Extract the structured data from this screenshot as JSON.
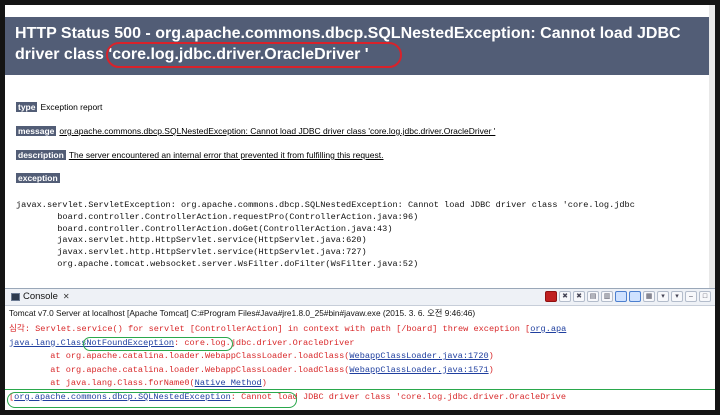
{
  "error_page": {
    "header_line1": "HTTP Status 500 - org.apache.commons.dbcp.SQLNestedException: Cannot load JDBC",
    "header_line2_prefix": "driver class ",
    "header_line2_class": "'core.log.jdbc.driver.OracleDriver '",
    "type_label": "type",
    "type_value": "Exception report",
    "message_label": "message",
    "message_value": "org.apache.commons.dbcp.SQLNestedException: Cannot load JDBC driver class 'core.log.jdbc.driver.OracleDriver '",
    "description_label": "description",
    "description_value": "The server encountered an internal error that prevented it from fulfilling this request.",
    "exception_label": "exception",
    "trace": [
      "javax.servlet.ServletException: org.apache.commons.dbcp.SQLNestedException: Cannot load JDBC driver class 'core.log.jdbc",
      "\tboard.controller.ControllerAction.requestPro(ControllerAction.java:96)",
      "\tboard.controller.ControllerAction.doGet(ControllerAction.java:43)",
      "\tjavax.servlet.http.HttpServlet.service(HttpServlet.java:620)",
      "\tjavax.servlet.http.HttpServlet.service(HttpServlet.java:727)",
      "\torg.apache.tomcat.websocket.server.WsFilter.doFilter(WsFilter.java:52)"
    ]
  },
  "console": {
    "tab_label": "Console",
    "tab_close": "✕",
    "info": "Tomcat v7.0 Server at localhost [Apache Tomcat] C:#Program Files#Java#jre1.8.0_25#bin#javaw.exe (2015. 3. 6. 오전 9:46:46)",
    "line1_text": "심각: Servlet.service() for servlet [ControllerAction] in context with path [/board] threw exception [",
    "line1_link": "org.apa",
    "line2_link": "java.lang.ClassNotFoundException",
    "line2_text": ": core.log.jdbc.driver.OracleDriver",
    "line3_prefix": "\tat org.apache.catalina.loader.WebappClassLoader.loadClass(",
    "line3_link": "WebappClassLoader.java:1720",
    "line4_prefix": "\tat org.apache.catalina.loader.WebappClassLoader.loadClass(",
    "line4_link": "WebappClassLoader.java:1571",
    "line5_prefix": "\tat java.lang.Class.forName0(",
    "line5_link": "Native Method",
    "line6_link": "org.apache.commons.dbcp.SQLNestedException",
    "line6_text": ": Cannot load JDBC driver class 'core.log.jdbc.driver.OracleDrive",
    "paren_close": ")",
    "bracket_close": "]"
  },
  "colors": {
    "header_bg": "#525d76",
    "annotation_red": "#d9222a",
    "annotation_green": "#2aa84c",
    "console_error": "#d8282a",
    "console_link": "#1f3f9f"
  },
  "icons": [
    "console-icon",
    "terminate-icon",
    "remove-launch-icon",
    "remove-all-icon",
    "clear-console-icon",
    "scroll-lock-icon",
    "show-on-output-icon",
    "show-on-error-icon",
    "pin-console-icon",
    "display-selected-console-icon",
    "open-console-icon",
    "minimize-icon",
    "maximize-icon"
  ]
}
